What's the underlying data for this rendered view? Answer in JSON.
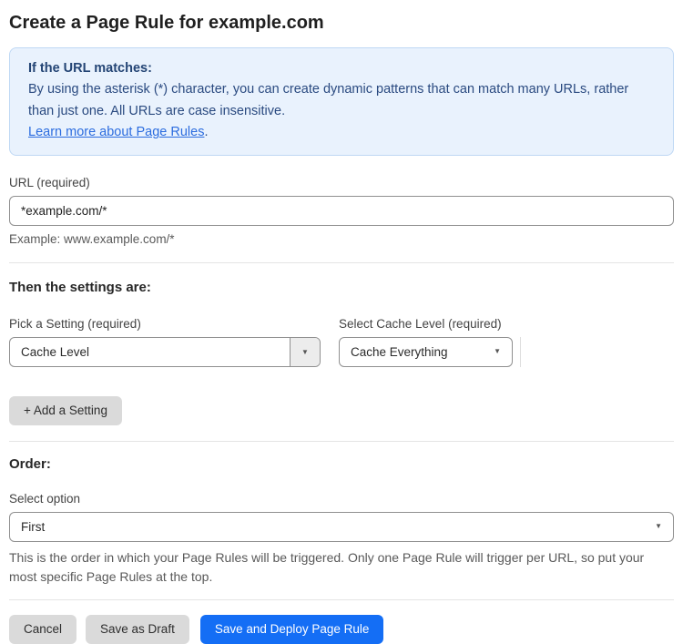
{
  "page": {
    "title": "Create a Page Rule for example.com"
  },
  "info_box": {
    "heading": "If the URL matches:",
    "body": "By using the asterisk (*) character, you can create dynamic patterns that can match many URLs, rather than just one. All URLs are case insensitive.",
    "link": "Learn more about Page Rules",
    "link_suffix": "."
  },
  "url_field": {
    "label": "URL (required)",
    "value": "*example.com/*",
    "helper": "Example: www.example.com/*"
  },
  "settings": {
    "heading": "Then the settings are:",
    "setting_label": "Pick a Setting (required)",
    "setting_value": "Cache Level",
    "cache_label": "Select Cache Level (required)",
    "cache_value": "Cache Everything",
    "add_button_label": "+ Add a Setting"
  },
  "order": {
    "heading": "Order:",
    "label": "Select option",
    "value": "First",
    "helper": "This is the order in which your Page Rules will be triggered. Only one Page Rule will trigger per URL, so put your most specific Page Rules at the top."
  },
  "actions": {
    "cancel": "Cancel",
    "save_draft": "Save as Draft",
    "save_deploy": "Save and Deploy Page Rule"
  },
  "icons": {
    "dropdown_arrow": "▼"
  },
  "colors": {
    "accent_blue": "#146ef5",
    "info_bg": "#e9f2fd",
    "info_border": "#bfd8f4",
    "info_text": "#2a4a80",
    "link_blue": "#2b6cdf",
    "button_gray": "#dadada"
  }
}
